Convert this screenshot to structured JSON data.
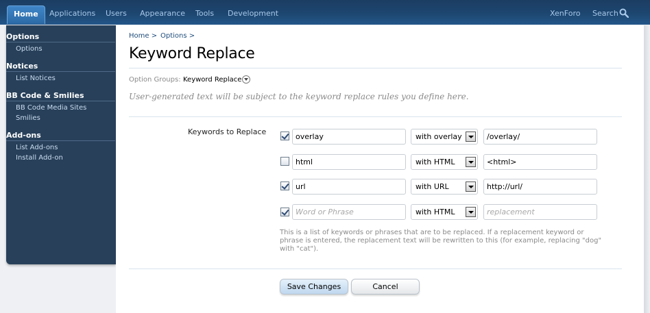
{
  "topnav": {
    "tabs": [
      {
        "label": "Home",
        "active": true
      },
      {
        "label": "Applications"
      },
      {
        "label": "Users"
      },
      {
        "label": "Appearance"
      },
      {
        "label": "Tools"
      },
      {
        "label": "Development"
      }
    ],
    "right_links": [
      "XenForo",
      "Search"
    ],
    "search_icon": "magnifier-icon"
  },
  "sidebar": {
    "sections": [
      {
        "title": "Options",
        "items": [
          "Options"
        ]
      },
      {
        "title": "Notices",
        "items": [
          "List Notices"
        ]
      },
      {
        "title": "BB Code & Smilies",
        "items": [
          "BB Code Media Sites",
          "Smilies"
        ]
      },
      {
        "title": "Add-ons",
        "items": [
          "List Add-ons",
          "Install Add-on"
        ]
      }
    ]
  },
  "breadcrumb": [
    "Home >",
    "Options >"
  ],
  "page_title": "Keyword Replace",
  "option_groups": {
    "label": "Option Groups:",
    "value": "Keyword Replace"
  },
  "description": "User-generated text will be subject to the keyword replace rules you define here.",
  "field_label": "Keywords to Replace",
  "rows": [
    {
      "checked": true,
      "word": "overlay",
      "word_placeholder": "",
      "type": "with overlay",
      "replacement": "/overlay/",
      "replacement_placeholder": ""
    },
    {
      "checked": false,
      "word": "html",
      "word_placeholder": "",
      "type": "with HTML",
      "replacement": "<html>",
      "replacement_placeholder": ""
    },
    {
      "checked": true,
      "word": "url",
      "word_placeholder": "",
      "type": "with URL",
      "replacement": "http://url/",
      "replacement_placeholder": ""
    },
    {
      "checked": true,
      "word": "",
      "word_placeholder": "Word or Phrase",
      "type": "with HTML",
      "replacement": "",
      "replacement_placeholder": "replacement"
    }
  ],
  "explain": "This is a list of keywords or phrases that are to be replaced. If a replacement keyword or phrase is entered, the replacement text will be rewritten to this (for example, replacing \"dog\" with \"cat\").",
  "buttons": {
    "save": "Save Changes",
    "cancel": "Cancel"
  },
  "colors": {
    "topbar": "#1d4670",
    "sidebar": "#28405a",
    "link": "#1d4b7a",
    "active_tab": "#3b7fc0"
  }
}
